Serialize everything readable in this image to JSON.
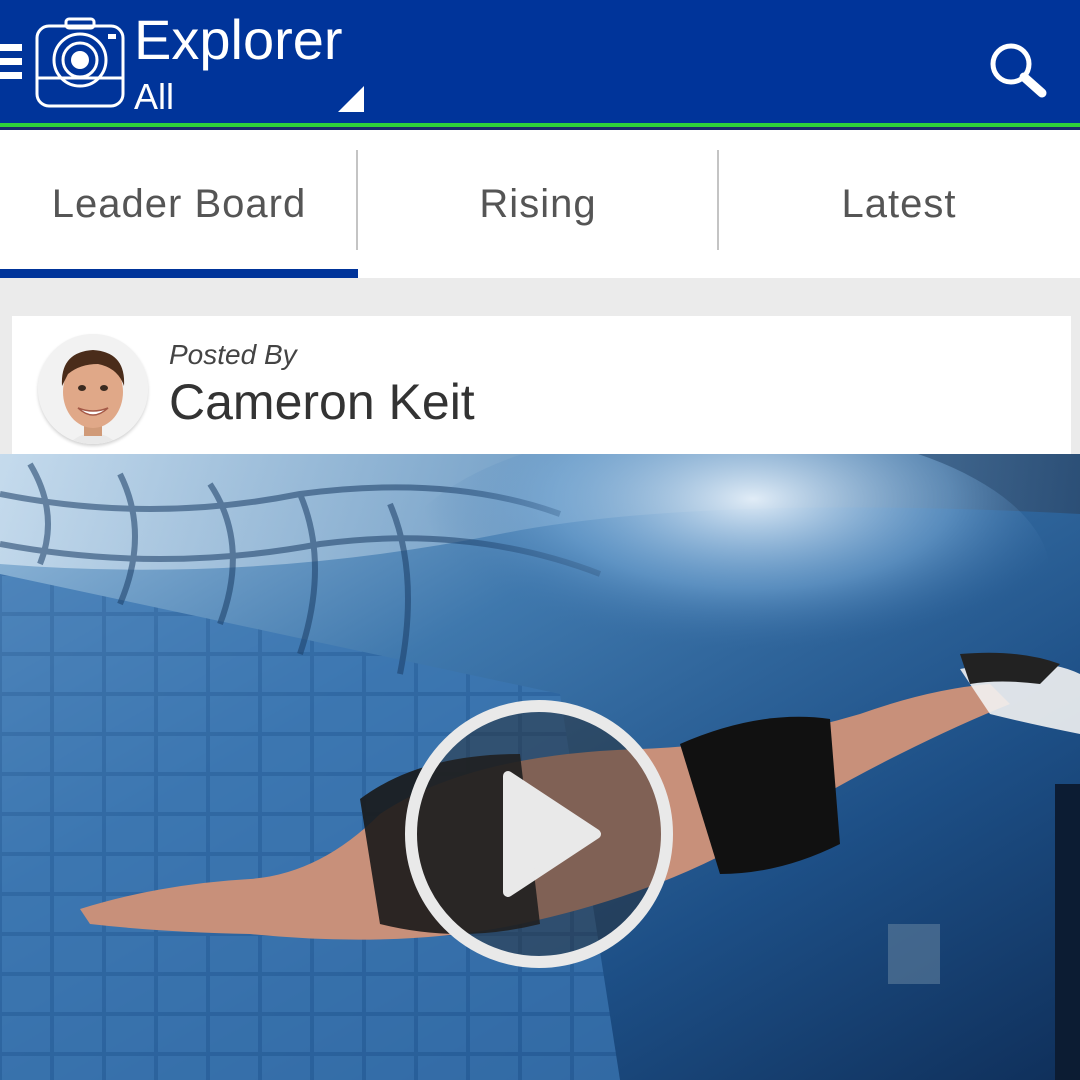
{
  "action_bar": {
    "title": "Explorer",
    "filter_value": "All",
    "colors": {
      "background": "#00349a",
      "accent": "#2fd23a"
    }
  },
  "icons": {
    "menu": "menu-icon",
    "logo": "camera-icon",
    "search": "search-icon",
    "play": "play-icon"
  },
  "tabs": [
    {
      "label": "Leader Board",
      "selected": true
    },
    {
      "label": "Rising",
      "selected": false
    },
    {
      "label": "Latest",
      "selected": false
    }
  ],
  "post": {
    "posted_by_label": "Posted By",
    "author": "Cameron Keit"
  }
}
